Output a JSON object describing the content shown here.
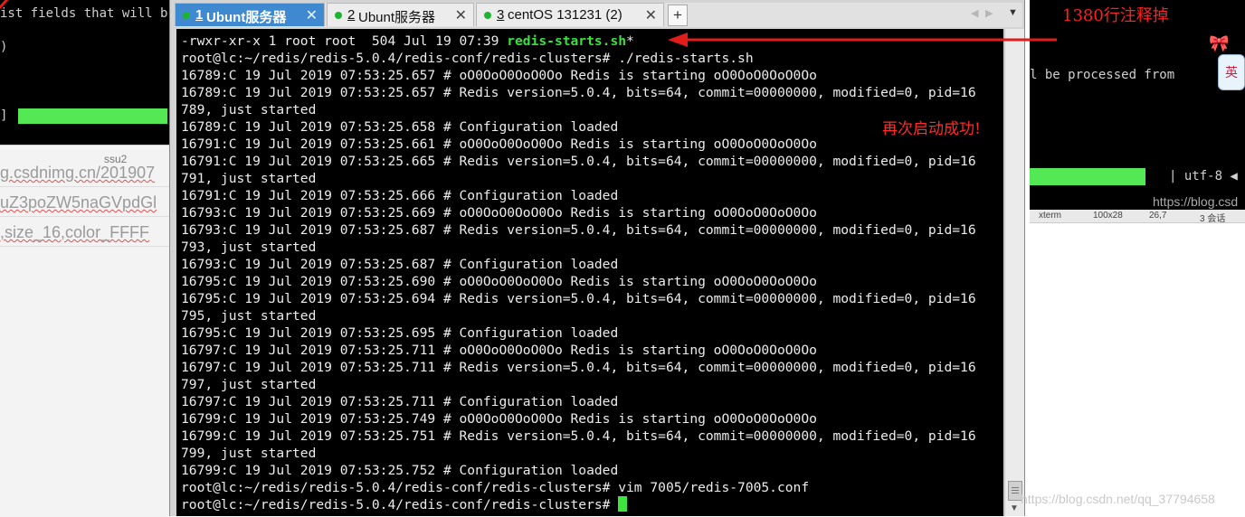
{
  "background_left": {
    "line1": "ist fields that will b",
    "line2": ")",
    "line3": "]",
    "tab_label": "ssu2",
    "url_lines": [
      "g.csdnimg.cn/201907",
      "uZ3poZW5naGVpdGl",
      ",size_16,color_FFFF"
    ]
  },
  "background_right": {
    "line1": "l be processed from",
    "encoding": "| utf-8 ◀",
    "url": "https://blog.csd",
    "status": [
      "xterm",
      "100x28",
      "26,7",
      "3 会话"
    ],
    "annotation": "1380行注释掉",
    "ime_label": "英"
  },
  "tabs": [
    {
      "num": "1",
      "label": "Ubunt服务器",
      "active": true,
      "status_color": "#1db431"
    },
    {
      "num": "2",
      "label": "Ubunt服务器",
      "active": false,
      "status_color": "#1db431"
    },
    {
      "num": "3",
      "label": "centOS  131231 (2)",
      "active": false,
      "status_color": "#1db431"
    }
  ],
  "add_tab_label": "+",
  "tab_nav": {
    "prev": "◀",
    "next": "▶",
    "menu": "▼"
  },
  "terminal": {
    "lines": [
      {
        "text": "-rwxr-xr-x 1 root root  504 Jul 19 07:39 ",
        "hl": "redis-starts.sh",
        "tail": "*"
      },
      {
        "text": "root@lc:~/redis/redis-5.0.4/redis-conf/redis-clusters# ./redis-starts.sh"
      },
      {
        "text": "16789:C 19 Jul 2019 07:53:25.657 # oO0OoO0OoO0Oo Redis is starting oO0OoO0OoO0Oo"
      },
      {
        "text": "16789:C 19 Jul 2019 07:53:25.657 # Redis version=5.0.4, bits=64, commit=00000000, modified=0, pid=16"
      },
      {
        "text": "789, just started"
      },
      {
        "text": "16789:C 19 Jul 2019 07:53:25.658 # Configuration loaded"
      },
      {
        "text": "16791:C 19 Jul 2019 07:53:25.661 # oO0OoO0OoO0Oo Redis is starting oO0OoO0OoO0Oo"
      },
      {
        "text": "16791:C 19 Jul 2019 07:53:25.665 # Redis version=5.0.4, bits=64, commit=00000000, modified=0, pid=16"
      },
      {
        "text": "791, just started"
      },
      {
        "text": "16791:C 19 Jul 2019 07:53:25.666 # Configuration loaded"
      },
      {
        "text": "16793:C 19 Jul 2019 07:53:25.669 # oO0OoO0OoO0Oo Redis is starting oO0OoO0OoO0Oo"
      },
      {
        "text": "16793:C 19 Jul 2019 07:53:25.687 # Redis version=5.0.4, bits=64, commit=00000000, modified=0, pid=16"
      },
      {
        "text": "793, just started"
      },
      {
        "text": "16793:C 19 Jul 2019 07:53:25.687 # Configuration loaded"
      },
      {
        "text": "16795:C 19 Jul 2019 07:53:25.690 # oO0OoO0OoO0Oo Redis is starting oO0OoO0OoO0Oo"
      },
      {
        "text": "16795:C 19 Jul 2019 07:53:25.694 # Redis version=5.0.4, bits=64, commit=00000000, modified=0, pid=16"
      },
      {
        "text": "795, just started"
      },
      {
        "text": "16795:C 19 Jul 2019 07:53:25.695 # Configuration loaded"
      },
      {
        "text": "16797:C 19 Jul 2019 07:53:25.711 # oO0OoO0OoO0Oo Redis is starting oO0OoO0OoO0Oo"
      },
      {
        "text": "16797:C 19 Jul 2019 07:53:25.711 # Redis version=5.0.4, bits=64, commit=00000000, modified=0, pid=16"
      },
      {
        "text": "797, just started"
      },
      {
        "text": "16797:C 19 Jul 2019 07:53:25.711 # Configuration loaded"
      },
      {
        "text": "16799:C 19 Jul 2019 07:53:25.749 # oO0OoO0OoO0Oo Redis is starting oO0OoO0OoO0Oo"
      },
      {
        "text": "16799:C 19 Jul 2019 07:53:25.751 # Redis version=5.0.4, bits=64, commit=00000000, modified=0, pid=16"
      },
      {
        "text": "799, just started"
      },
      {
        "text": "16799:C 19 Jul 2019 07:53:25.752 # Configuration loaded"
      },
      {
        "text": "root@lc:~/redis/redis-5.0.4/redis-conf/redis-clusters# vim 7005/redis-7005.conf"
      },
      {
        "text": "root@lc:~/redis/redis-5.0.4/redis-conf/redis-clusters# ",
        "cursor": true
      }
    ]
  },
  "annotation_main": "再次启动成功!",
  "watermark": "https://blog.csdn.net/qq_37794658",
  "colors": {
    "accent_tab": "#3f89d0",
    "terminal_bg": "#000000",
    "highlight": "#39e13c",
    "annotation": "#ff2020"
  }
}
